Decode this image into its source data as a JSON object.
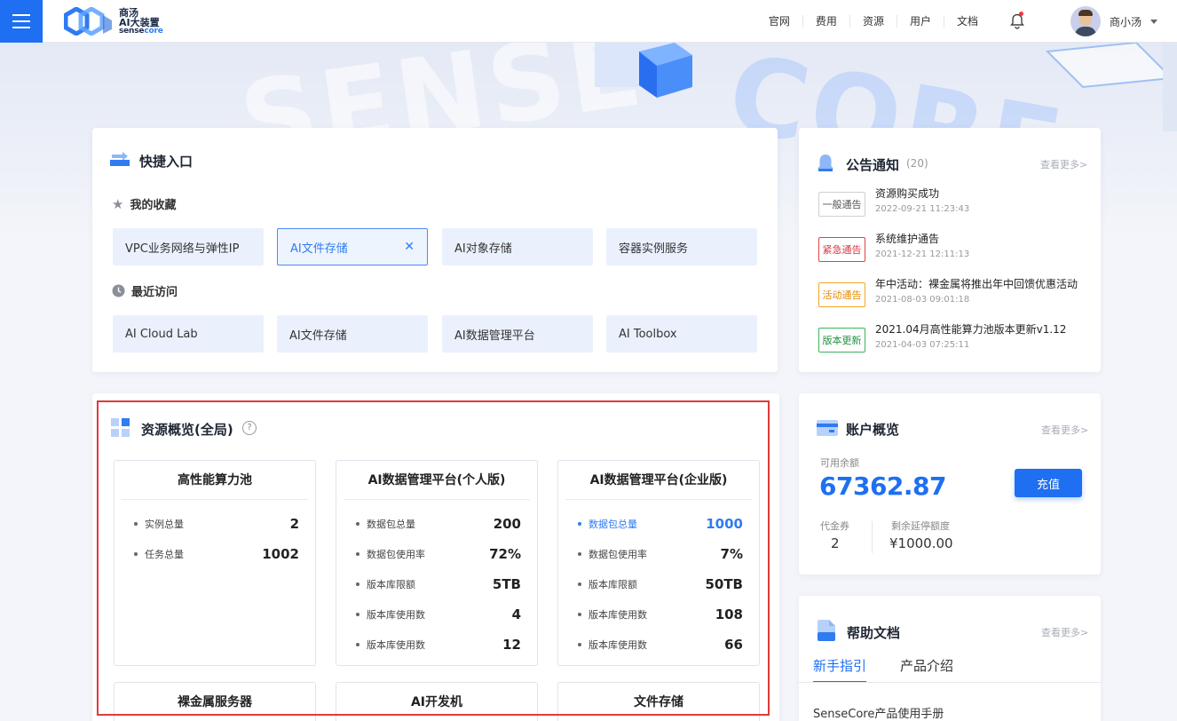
{
  "header": {
    "logo_cn1": "商汤",
    "logo_cn2": "AI大装置",
    "logo_en_a": "sense",
    "logo_en_b": "core",
    "nav": [
      "官网",
      "费用",
      "资源",
      "用户",
      "文档"
    ],
    "user_name": "商小汤",
    "brand_color": "#1e6ff1"
  },
  "hero": {
    "word_left": "SENSE",
    "word_right": "CORE"
  },
  "quick": {
    "title": "快捷入口",
    "favorites_title": "我的收藏",
    "favorites": [
      "VPC业务网络与弹性IP",
      "AI文件存储",
      "AI对象存储",
      "容器实例服务"
    ],
    "favorite_close": "✕",
    "recent_title": "最近访问",
    "recent": [
      "AI Cloud Lab",
      "AI文件存储",
      "AI数据管理平台",
      "AI Toolbox"
    ]
  },
  "notice": {
    "title": "公告通知",
    "count": "(20)",
    "more": "查看更多>",
    "items": [
      {
        "tag": "一般通告",
        "title": "资源购买成功",
        "date": "2022-09-21  11:23:43"
      },
      {
        "tag": "紧急通告",
        "title": "系统维护通告",
        "date": "2021-12-21  12:11:13"
      },
      {
        "tag": "活动通告",
        "title": "年中活动：裸金属将推出年中回馈优惠活动",
        "date": "2021-08-03  09:01:18"
      },
      {
        "tag": "版本更新",
        "title": "2021.04月高性能算力池版本更新v1.12",
        "date": "2021-04-03  07:25:11"
      }
    ]
  },
  "resources": {
    "title": "资源概览(全局)",
    "help": "?",
    "boxes": [
      {
        "title": "高性能算力池",
        "rows": [
          {
            "label": "实例总量",
            "value": "2"
          },
          {
            "label": "任务总量",
            "value": "1002"
          }
        ]
      },
      {
        "title": "AI数据管理平台(个人版)",
        "rows": [
          {
            "label": "数据包总量",
            "value": "200"
          },
          {
            "label": "数据包使用率",
            "value": "72%"
          },
          {
            "label": "版本库限额",
            "value": "5TB"
          },
          {
            "label": "版本库使用数",
            "value": "4"
          },
          {
            "label": "版本库使用数",
            "value": "12"
          }
        ]
      },
      {
        "title": "AI数据管理平台(企业版)",
        "rows": [
          {
            "label": "数据包总量",
            "value": "1000"
          },
          {
            "label": "数据包使用率",
            "value": "7%"
          },
          {
            "label": "版本库限额",
            "value": "50TB"
          },
          {
            "label": "版本库使用数",
            "value": "108"
          },
          {
            "label": "版本库使用数",
            "value": "66"
          }
        ]
      }
    ],
    "bottom_titles": [
      "裸金属服务器",
      "AI开发机",
      "文件存储"
    ]
  },
  "account": {
    "title": "账户概览",
    "more": "查看更多>",
    "balance_label": "可用余额",
    "balance": "67362.87",
    "recharge": "充值",
    "voucher_label": "代金券",
    "voucher": "2",
    "deferral_label": "剩余延停额度",
    "deferral": "¥1000.00"
  },
  "help": {
    "title": "帮助文档",
    "more": "查看更多>",
    "tabs": [
      "新手指引",
      "产品介绍"
    ],
    "first_item": "SenseCore产品使用手册"
  }
}
